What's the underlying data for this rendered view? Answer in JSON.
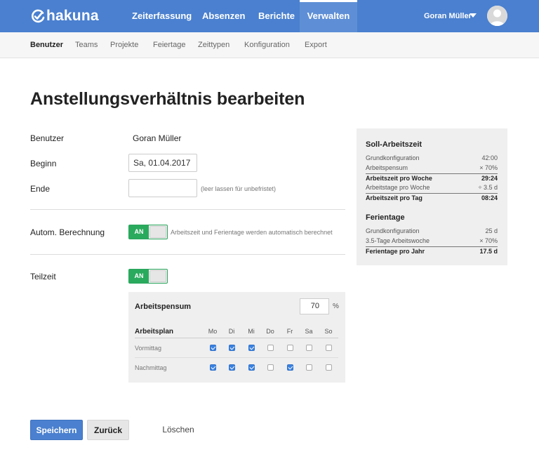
{
  "header": {
    "logo_text": "hakuna",
    "nav": [
      {
        "label": "Zeiterfassung"
      },
      {
        "label": "Absenzen"
      },
      {
        "label": "Berichte"
      },
      {
        "label": "Verwalten"
      }
    ],
    "user_name": "Goran Müller"
  },
  "subnav": [
    {
      "label": "Benutzer"
    },
    {
      "label": "Teams"
    },
    {
      "label": "Projekte"
    },
    {
      "label": "Feiertage"
    },
    {
      "label": "Zeittypen"
    },
    {
      "label": "Konfiguration"
    },
    {
      "label": "Export"
    }
  ],
  "page_title": "Anstellungsverhältnis bearbeiten",
  "form": {
    "user_label": "Benutzer",
    "user_value": "Goran Müller",
    "start_label": "Beginn",
    "start_value": "Sa, 01.04.2017",
    "end_label": "Ende",
    "end_value": "",
    "end_hint": "(leer lassen für unbefristet)",
    "auto_calc_label": "Autom. Berechnung",
    "auto_calc_toggle": "AN",
    "auto_calc_hint": "Arbeitszeit und Ferientage werden automatisch berechnet",
    "parttime_label": "Teilzeit",
    "parttime_toggle": "AN"
  },
  "parttime_panel": {
    "pensum_label": "Arbeitspensum",
    "pensum_value": "70",
    "pensum_unit": "%",
    "plan_label": "Arbeitsplan",
    "days": [
      "Mo",
      "Di",
      "Mi",
      "Do",
      "Fr",
      "Sa",
      "So"
    ],
    "rows": [
      {
        "label": "Vormittag",
        "checked": [
          true,
          true,
          true,
          false,
          false,
          false,
          false
        ]
      },
      {
        "label": "Nachmittag",
        "checked": [
          true,
          true,
          true,
          false,
          true,
          false,
          false
        ]
      }
    ]
  },
  "summary": {
    "soll_title": "Soll-Arbeitszeit",
    "soll_rows": [
      {
        "label": "Grundkonfiguration",
        "value": "42:00"
      },
      {
        "label": "Arbeitspensum",
        "value": "×  70%"
      },
      {
        "label": "Arbeitszeit pro Woche",
        "value": "29:24"
      },
      {
        "label": "Arbeitstage pro Woche",
        "value": "÷ 3.5 d"
      },
      {
        "label": "Arbeitszeit pro Tag",
        "value": "08:24"
      }
    ],
    "ferien_title": "Ferientage",
    "ferien_rows": [
      {
        "label": "Grundkonfiguration",
        "value": "25 d"
      },
      {
        "label": "3.5-Tage Arbeitswoche",
        "value": "×  70%"
      },
      {
        "label": "Ferientage pro Jahr",
        "value": "17.5 d"
      }
    ]
  },
  "actions": {
    "save": "Speichern",
    "back": "Zurück",
    "delete": "Löschen"
  },
  "colors": {
    "brand_blue": "#4a80cf",
    "toggle_green": "#2aaa5d",
    "checkbox_blue": "#3b82e0"
  }
}
